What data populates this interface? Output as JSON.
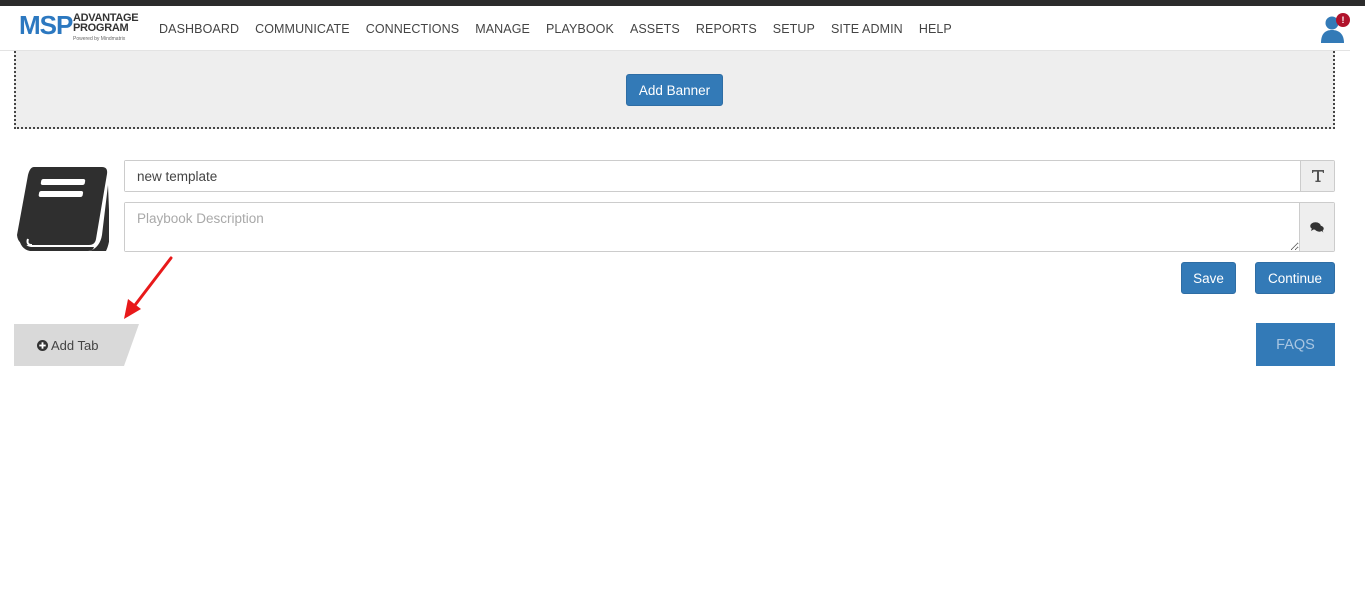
{
  "header": {
    "logo": {
      "brand": "MSP",
      "line1": "ADVANTAGE",
      "line2": "PROGRAM",
      "tagline": "Powered by Mindmatrix"
    },
    "nav": [
      "DASHBOARD",
      "COMMUNICATE",
      "CONNECTIONS",
      "MANAGE",
      "PLAYBOOK",
      "ASSETS",
      "REPORTS",
      "SETUP",
      "SITE ADMIN",
      "HELP"
    ],
    "user": {
      "icon": "user-icon",
      "badge": "!"
    }
  },
  "banner": {
    "add_label": "Add Banner"
  },
  "form": {
    "icon": "book-icon",
    "title_value": "new template",
    "title_addon_icon": "text-format-icon",
    "description_placeholder": "Playbook Description",
    "description_addon_icon": "comments-icon"
  },
  "actions": {
    "save": "Save",
    "continue": "Continue"
  },
  "tabs": {
    "add_tab": "Add Tab",
    "faqs": "FAQS"
  },
  "colors": {
    "primary": "#337ab7",
    "logo_blue": "#2c78c0",
    "badge_red": "#b0122b",
    "annotation_arrow": "#e8191a",
    "banner_bg": "#eeeeee",
    "tab_bg": "#d9d9d9"
  }
}
